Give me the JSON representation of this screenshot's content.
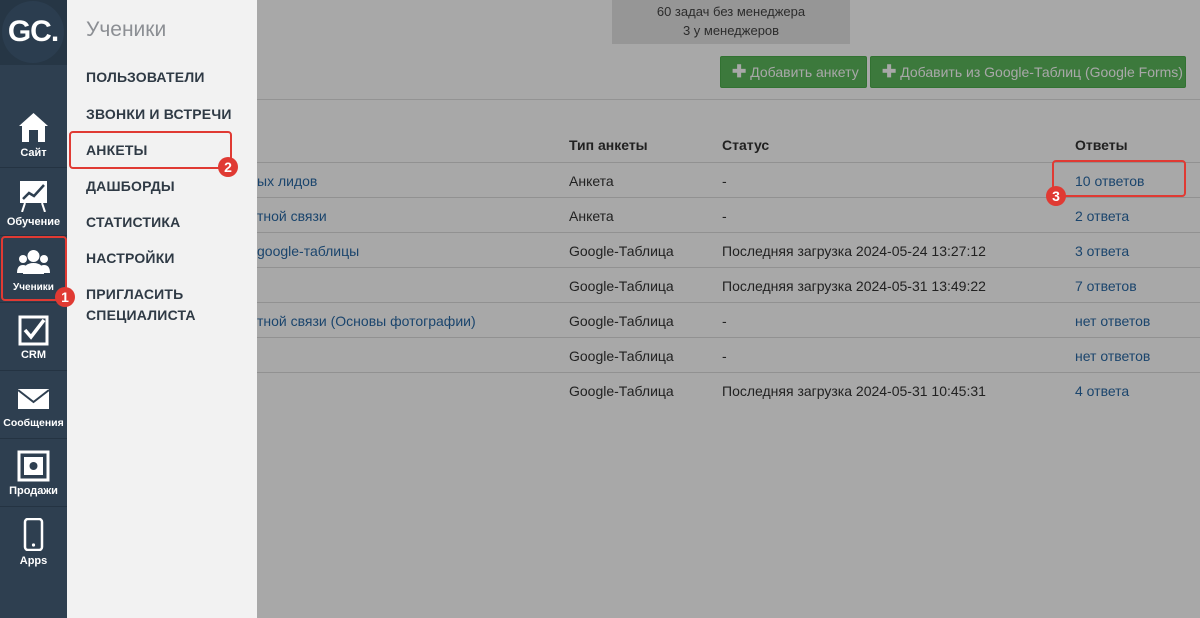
{
  "header": {
    "tasks_line1": "60 задач без менеджера",
    "tasks_line2": "3 у менеджеров",
    "add_form_label": "Добавить анкету",
    "add_gsheet_label": "Добавить из Google-Таблиц (Google Forms)"
  },
  "table": {
    "headers": {
      "type": "Тип анкеты",
      "status": "Статус",
      "answers": "Ответы"
    },
    "rows": [
      {
        "name": "ых лидов",
        "type": "Анкета",
        "status": "-",
        "answers": "10 ответов"
      },
      {
        "name": "тной связи",
        "type": "Анкета",
        "status": "-",
        "answers": "2 ответа"
      },
      {
        "name": "google-таблицы",
        "type": "Google-Таблица",
        "status": "Последняя загрузка 2024-05-24 13:27:12",
        "answers": "3 ответа"
      },
      {
        "name": "",
        "type": "Google-Таблица",
        "status": "Последняя загрузка 2024-05-31 13:49:22",
        "answers": "7 ответов"
      },
      {
        "name": "тной связи (Основы фотографии)",
        "type": "Google-Таблица",
        "status": "-",
        "answers": "нет ответов"
      },
      {
        "name": "",
        "type": "Google-Таблица",
        "status": "-",
        "answers": "нет ответов"
      },
      {
        "name": "",
        "type": "Google-Таблица",
        "status": "Последняя загрузка 2024-05-31 10:45:31",
        "answers": "4 ответа"
      }
    ]
  },
  "iconbar": {
    "logo": "GC.",
    "items": [
      {
        "label": "Сайт",
        "icon": "home-icon"
      },
      {
        "label": "Обучение",
        "icon": "chart-easel-icon"
      },
      {
        "label": "Ученики",
        "icon": "users-icon"
      },
      {
        "label": "CRM",
        "icon": "checkbox-icon"
      },
      {
        "label": "Сообщения",
        "icon": "envelope-icon"
      },
      {
        "label": "Продажи",
        "icon": "safe-icon"
      },
      {
        "label": "Apps",
        "icon": "phone-icon"
      }
    ]
  },
  "panel": {
    "title": "Ученики",
    "items": [
      "ПОЛЬЗОВАТЕЛИ",
      "ЗВОНКИ И ВСТРЕЧИ",
      "АНКЕТЫ",
      "ДАШБОРДЫ",
      "СТАТИСТИКА",
      "НАСТРОЙКИ",
      "ПРИГЛАСИТЬ СПЕЦИАЛИСТА"
    ]
  },
  "annotations": {
    "n1": "1",
    "n2": "2",
    "n3": "3"
  },
  "colors": {
    "accent_green": "#5cb85c",
    "annotation_red": "#e03a33",
    "sidebar_dark": "#2e3f50",
    "link_blue": "#2a6aa6"
  }
}
